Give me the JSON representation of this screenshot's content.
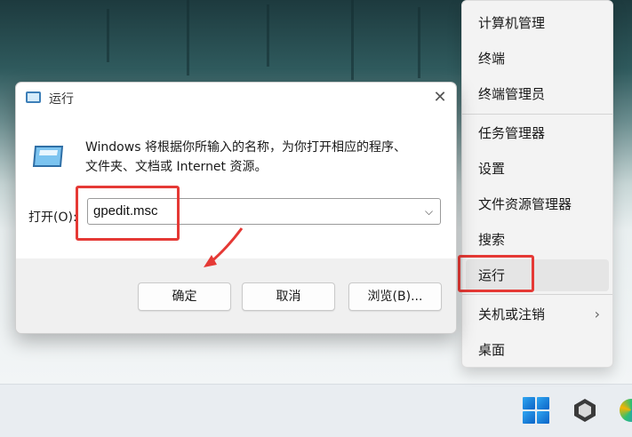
{
  "context_menu": {
    "items": [
      {
        "label": "计算机管理"
      },
      {
        "label": "终端"
      },
      {
        "label": "终端管理员"
      },
      {
        "label": "任务管理器"
      },
      {
        "label": "设置"
      },
      {
        "label": "文件资源管理器"
      },
      {
        "label": "搜索"
      },
      {
        "label": "运行"
      },
      {
        "label": "关机或注销",
        "chevron": "›"
      },
      {
        "label": "桌面"
      }
    ]
  },
  "run_dialog": {
    "title": "运行",
    "close_glyph": "✕",
    "description_line1": "Windows 将根据你所输入的名称，为你打开相应的程序、",
    "description_line2": "文件夹、文档或 Internet 资源。",
    "open_label": "打开(O):",
    "open_value": "gpedit.msc",
    "dropdown_glyph": "⌵",
    "ok_label": "确定",
    "cancel_label": "取消",
    "browse_label": "浏览(B)..."
  },
  "annotations": {
    "highlight_color": "#e53935"
  }
}
